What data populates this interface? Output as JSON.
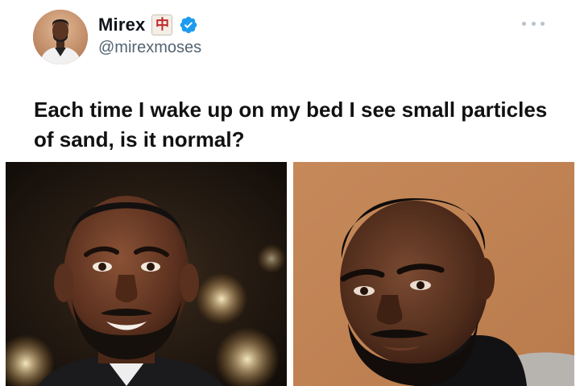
{
  "author": {
    "display_name": "Mirex",
    "handle": "@mirexmoses",
    "name_emoji": "中",
    "verified": true,
    "verified_color": "#1d9bf0"
  },
  "tweet": {
    "text": "Each time I wake up on my bed I see small particles of sand, is it normal?"
  },
  "media": [
    {
      "icon": "photo-portrait-smiling-man"
    },
    {
      "icon": "photo-portrait-serious-man"
    }
  ],
  "menu": {
    "icon": "more-icon"
  }
}
